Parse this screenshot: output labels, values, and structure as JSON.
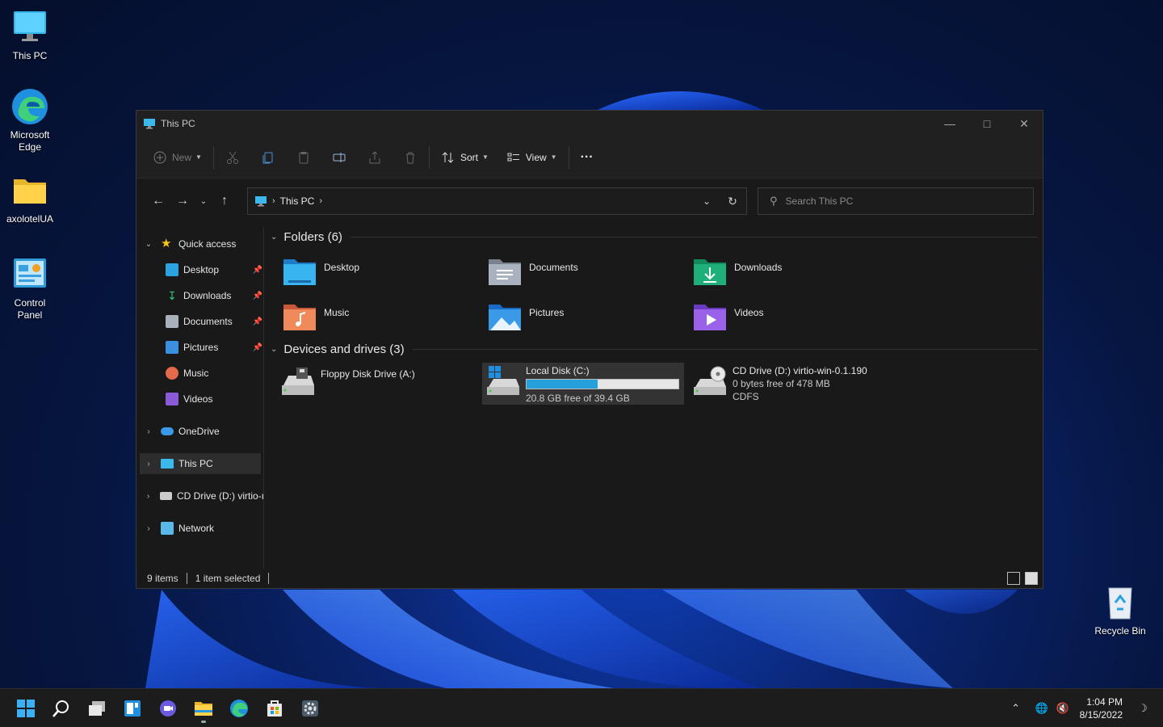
{
  "desktop": {
    "icons": [
      {
        "label": "This PC"
      },
      {
        "label": "Microsoft Edge"
      },
      {
        "label": "axolotelUA"
      },
      {
        "label": "Control Panel"
      },
      {
        "label": "Recycle Bin"
      }
    ]
  },
  "window": {
    "title": "This PC",
    "toolbar": {
      "new_label": "New",
      "sort_label": "Sort",
      "view_label": "View",
      "more_label": "···"
    },
    "address": {
      "crumbs": [
        "This PC"
      ]
    },
    "search": {
      "placeholder": "Search This PC"
    },
    "sidebar": {
      "quick_access": "Quick access",
      "quick_items": [
        {
          "label": "Desktop",
          "pinned": true
        },
        {
          "label": "Downloads",
          "pinned": true
        },
        {
          "label": "Documents",
          "pinned": true
        },
        {
          "label": "Pictures",
          "pinned": true
        },
        {
          "label": "Music",
          "pinned": false
        },
        {
          "label": "Videos",
          "pinned": false
        }
      ],
      "onedrive": "OneDrive",
      "thispc": "This PC",
      "cddrive": "CD Drive (D:) virtio-ı",
      "network": "Network"
    },
    "folders": {
      "heading": "Folders (6)",
      "items": [
        "Desktop",
        "Documents",
        "Downloads",
        "Music",
        "Pictures",
        "Videos"
      ]
    },
    "drives": {
      "heading": "Devices and drives (3)",
      "floppy": {
        "name": "Floppy Disk Drive (A:)"
      },
      "local": {
        "name": "Local Disk (C:)",
        "free": "20.8 GB free of 39.4 GB",
        "used_fraction": 0.47
      },
      "cd": {
        "name": "CD Drive (D:) virtio-win-0.1.190",
        "free": "0 bytes free of 478 MB",
        "fs": "CDFS"
      }
    },
    "status": {
      "items": "9 items",
      "selected": "1 item selected"
    }
  },
  "taskbar": {
    "time": "1:04 PM",
    "date": "8/15/2022"
  },
  "colors": {
    "accent": "#26a0da",
    "window_bg": "#191919",
    "taskbar_bg": "#1c1c1c"
  }
}
